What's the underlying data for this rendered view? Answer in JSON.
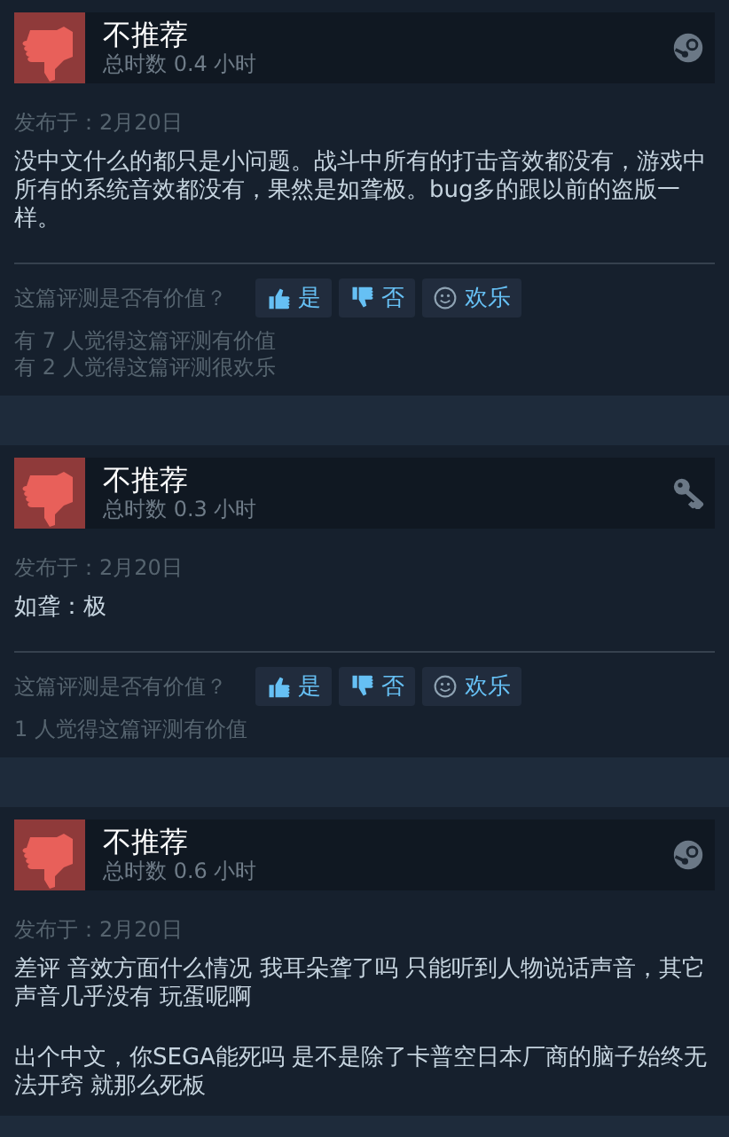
{
  "reviews": [
    {
      "verdict": "不推荐",
      "hours": "总时数 0.4 小时",
      "kind": "steam",
      "date": "发布于：2月20日",
      "body": [
        "没中文什么的都只是小问题。战斗中所有的打击音效都没有，游戏中所有的系统音效都没有，果然是如聋极。bug多的跟以前的盗版一样。"
      ],
      "vote": {
        "question": "这篇评测是否有价值？",
        "buttons": [
          {
            "kind": "up",
            "label": "是"
          },
          {
            "kind": "down",
            "label": "否"
          },
          {
            "kind": "funny",
            "label": "欢乐"
          }
        ]
      },
      "counts": [
        "有 7 人觉得这篇评测有价值",
        "有 2 人觉得这篇评测很欢乐"
      ]
    },
    {
      "verdict": "不推荐",
      "hours": "总时数 0.3 小时",
      "kind": "key",
      "date": "发布于：2月20日",
      "body": [
        "如聋：极"
      ],
      "vote": {
        "question": "这篇评测是否有价值？",
        "buttons": [
          {
            "kind": "up",
            "label": "是"
          },
          {
            "kind": "down",
            "label": "否"
          },
          {
            "kind": "funny",
            "label": "欢乐"
          }
        ]
      },
      "counts": [
        "1 人觉得这篇评测有价值"
      ]
    },
    {
      "verdict": "不推荐",
      "hours": "总时数 0.6 小时",
      "kind": "steam",
      "date": "发布于：2月20日",
      "body": [
        "差评 音效方面什么情况 我耳朵聋了吗 只能听到人物说话声音，其它声音几乎没有 玩蛋呢啊",
        "出个中文，你SEGA能死吗 是不是除了卡普空日本厂商的脑子始终无法开窍 就那么死板"
      ]
    }
  ]
}
